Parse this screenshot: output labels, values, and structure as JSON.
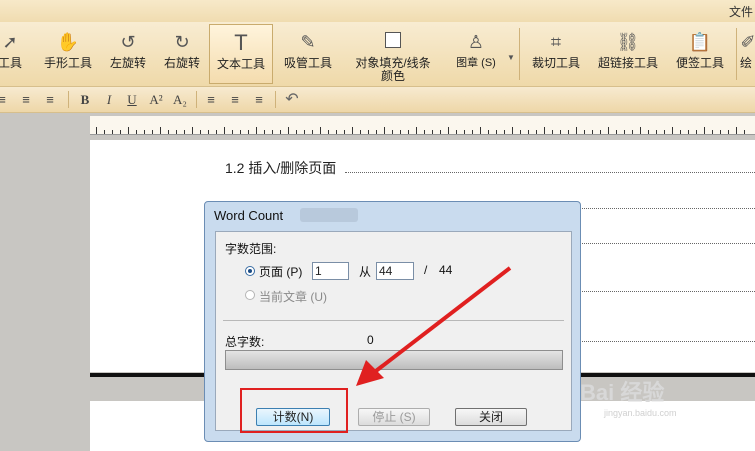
{
  "window": {
    "title": "文件"
  },
  "toolbar": {
    "tools": [
      {
        "label": "工具",
        "icon": "arrow-icon"
      },
      {
        "label": "手形工具",
        "icon": "hand-icon"
      },
      {
        "label": "左旋转",
        "icon": "rotate-left-icon"
      },
      {
        "label": "右旋转",
        "icon": "rotate-right-icon"
      },
      {
        "label": "文本工具",
        "icon": "text-tool-icon"
      },
      {
        "label": "吸管工具",
        "icon": "eyedropper-icon"
      },
      {
        "label": "对象填充/线条颜色",
        "icon": "fill-square-icon"
      },
      {
        "label": "图章 (S)",
        "icon": "stamp-icon"
      },
      {
        "label": "裁切工具",
        "icon": "crop-icon"
      },
      {
        "label": "超链接工具",
        "icon": "link-icon"
      },
      {
        "label": "便签工具",
        "icon": "note-icon"
      },
      {
        "label": "绘",
        "icon": "draw-icon"
      }
    ]
  },
  "format_bar": {
    "items": [
      "≡",
      "≡",
      "≡",
      "B",
      "I",
      "U",
      "A²",
      "A₂",
      "≡",
      "≡",
      "≡",
      "↶"
    ]
  },
  "document": {
    "heading": "1.2 插入/删除页面"
  },
  "dialog": {
    "title": "Word Count",
    "range_label": "字数范围:",
    "page_option": "页面 (P)",
    "page_from": "1",
    "from_label": "从",
    "page_to": "44",
    "slash": "/",
    "page_total": "44",
    "current_article": "当前文章 (U)",
    "total_label": "总字数:",
    "total_value": "0",
    "progress_percent": 0,
    "count_button": "计数(N)",
    "stop_button": "停止 (S)",
    "close_button": "关闭"
  },
  "watermark": {
    "brand": "Bai 经验",
    "url": "jingyan.baidu.com"
  },
  "colors": {
    "highlight_box": "#e02020",
    "arrow": "#e02020",
    "toolbar_bg": "#efd9a9"
  }
}
